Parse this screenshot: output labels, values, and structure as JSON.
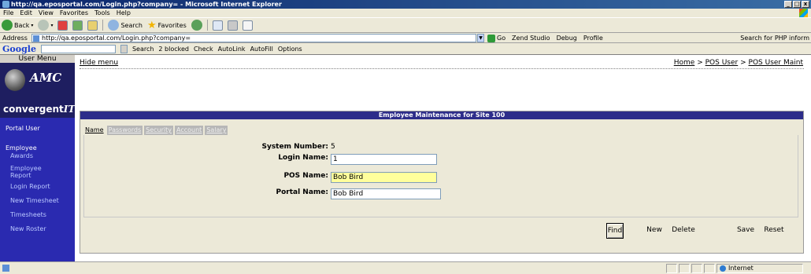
{
  "window": {
    "title": "http://qa.eposportal.com/Login.php?company= - Microsoft Internet Explorer",
    "buttons": [
      "_",
      "□",
      "x"
    ]
  },
  "menubar": [
    "File",
    "Edit",
    "View",
    "Favorites",
    "Tools",
    "Help"
  ],
  "toolbar": {
    "back": "Back",
    "search": "Search",
    "favorites": "Favorites"
  },
  "address": {
    "label": "Address",
    "url": "http://qa.eposportal.com/Login.php?company=",
    "go": "Go",
    "zend_studio": "Zend Studio",
    "debug": "Debug",
    "profile": "Profile",
    "search_php": "Search for PHP inform"
  },
  "googlebar": {
    "logo": "Google",
    "search": "Search",
    "blocked": "2 blocked",
    "check": "Check",
    "autolink": "AutoLink",
    "autofill": "AutoFill",
    "options": "Options"
  },
  "sidebar": {
    "title": "User Menu",
    "logo_amc": "AMC",
    "logo_convergent": "convergent",
    "logo_it": "IT",
    "items": [
      {
        "label": "Portal User"
      },
      {
        "label": "Employee"
      },
      {
        "label": "Awards"
      },
      {
        "label": "Employee Report"
      },
      {
        "label": "Login Report"
      },
      {
        "label": "New Timesheet"
      },
      {
        "label": "Timesheets"
      },
      {
        "label": "New Roster"
      }
    ]
  },
  "main": {
    "hide_menu": "Hide menu",
    "breadcrumb": [
      "Home",
      "POS User",
      "POS User Maint"
    ],
    "breadcrumb_sep": ">",
    "panel_title": "Employee Maintenance for Site 100",
    "tabs": [
      "Name",
      "Passwords",
      "Security",
      "Account",
      "Salary"
    ],
    "active_tab": "Name",
    "form": {
      "system_number_label": "System Number:",
      "system_number": "5",
      "login_name_label": "Login Name:",
      "login_name": "1",
      "pos_name_label": "POS Name:",
      "pos_name": "Bob Bird",
      "portal_name_label": "Portal Name:",
      "portal_name": "Bob Bird"
    },
    "buttons": {
      "find": "Find",
      "new": "New",
      "delete": "Delete",
      "save": "Save",
      "reset": "Reset"
    }
  },
  "statusbar": {
    "zone": "Internet"
  }
}
